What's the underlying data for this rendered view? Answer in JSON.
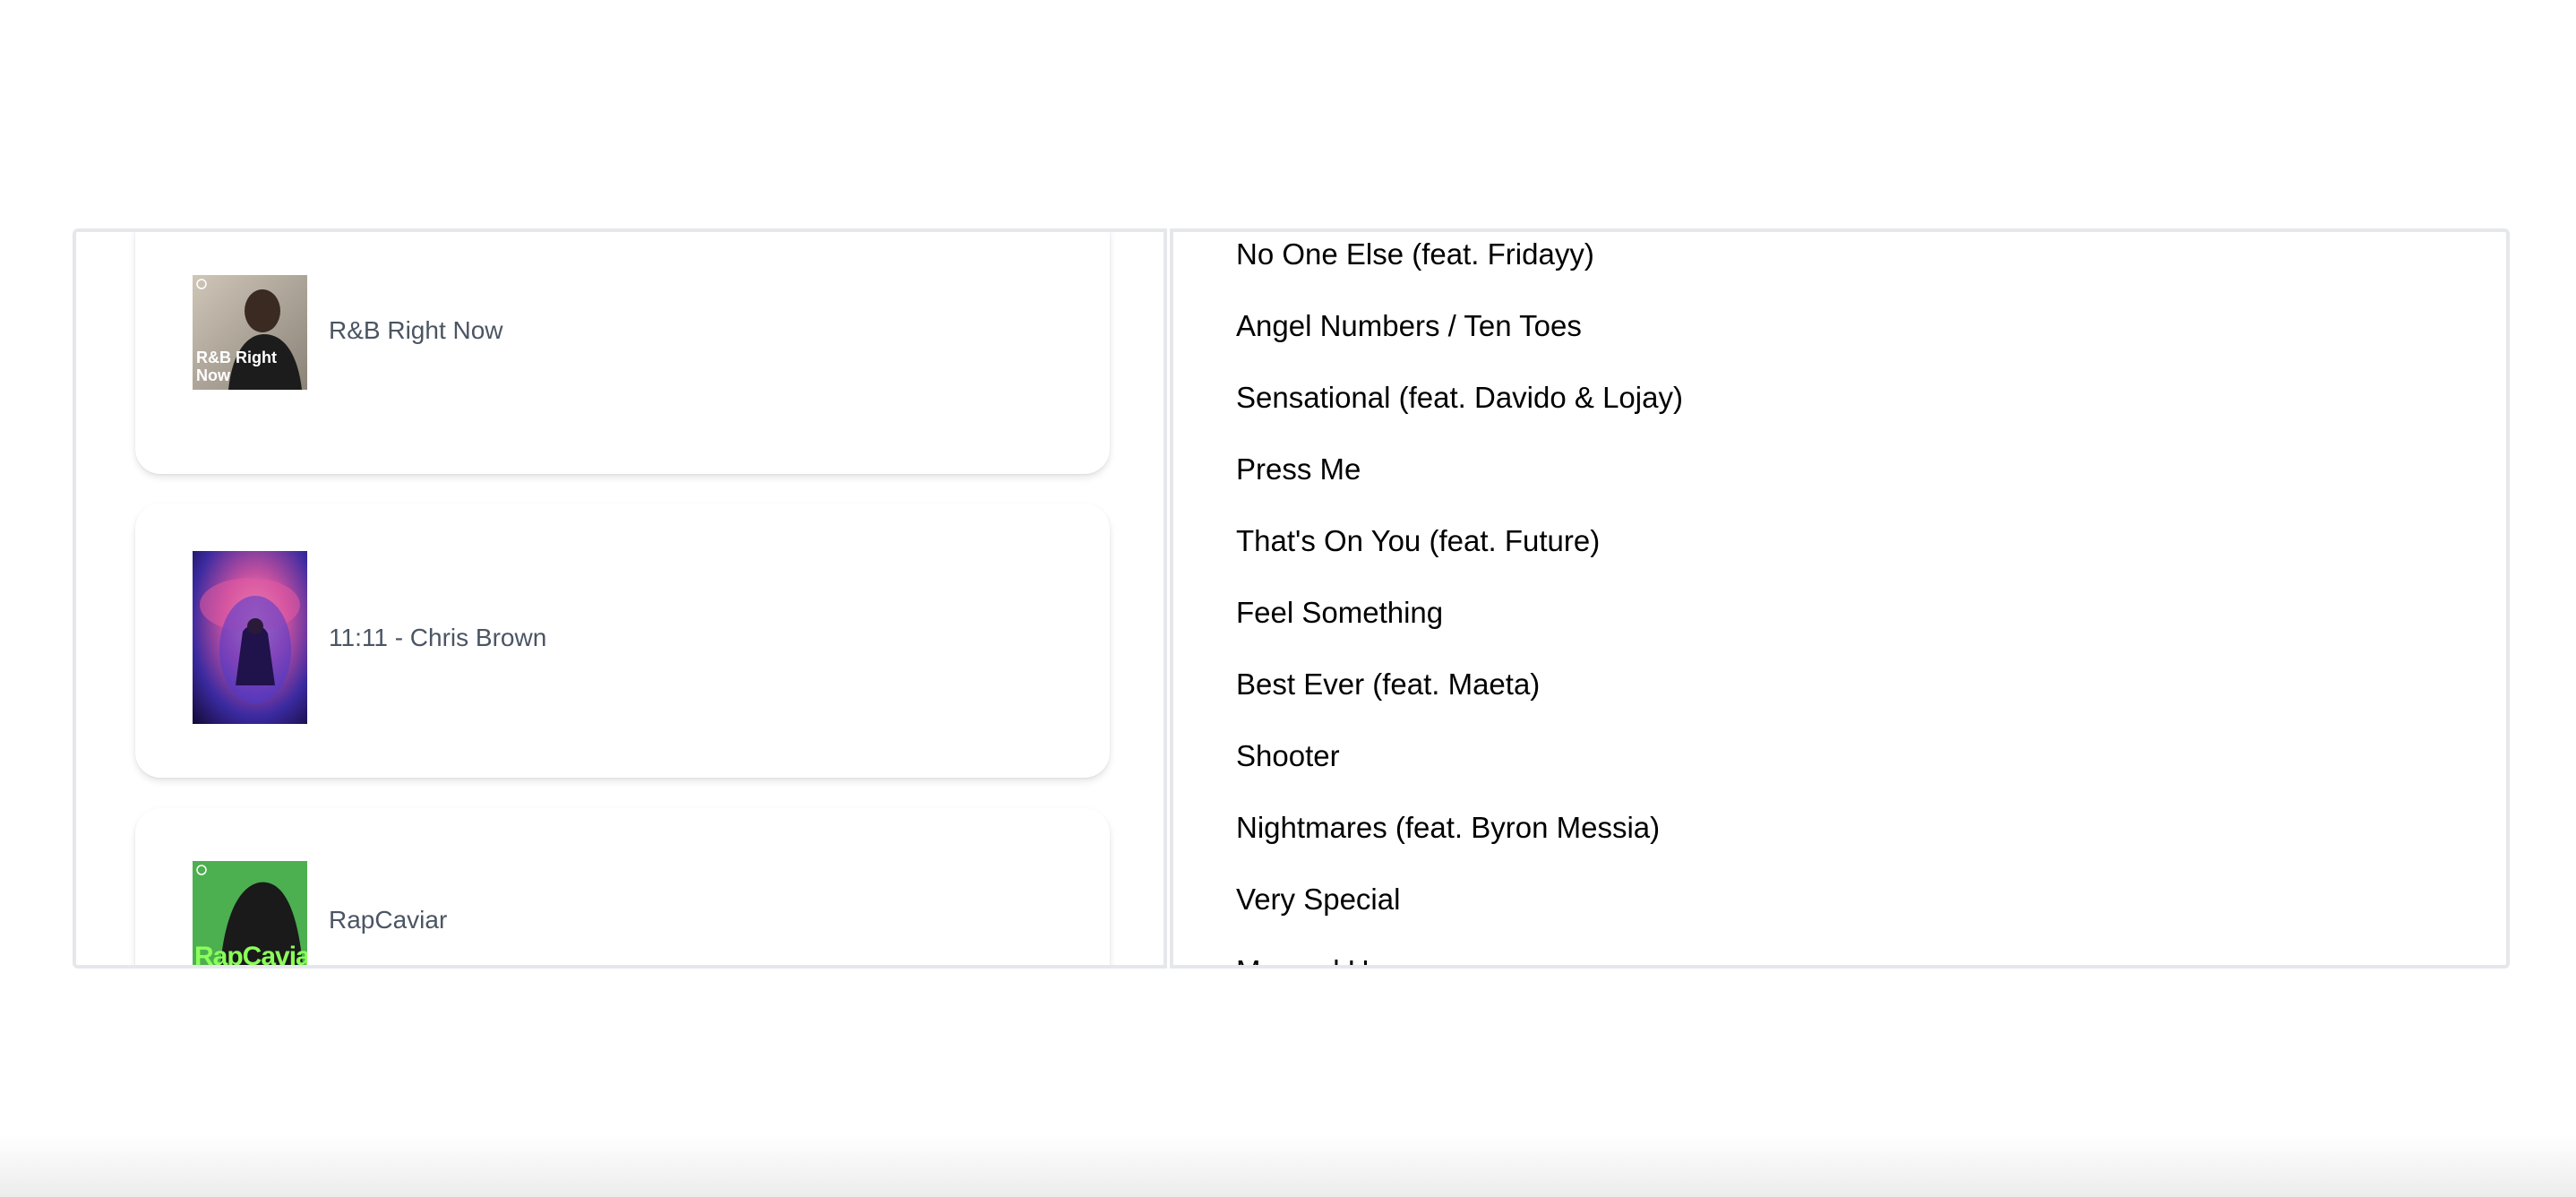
{
  "playlists": [
    {
      "name": "R&B Right Now",
      "cover_text": "R&B Right Now",
      "cover_icon": "spotify-icon"
    },
    {
      "name": "11:11 - Chris Brown",
      "cover_text": "",
      "cover_icon": ""
    },
    {
      "name": "RapCaviar",
      "cover_text": "RapCaviar",
      "cover_icon": "spotify-icon"
    }
  ],
  "tracks": [
    "No One Else (feat. Fridayy)",
    "Angel Numbers / Ten Toes",
    "Sensational (feat. Davido & Lojay)",
    "Press Me",
    "That's On You (feat. Future)",
    "Feel Something",
    "Best Ever (feat. Maeta)",
    "Shooter",
    "Nightmares (feat. Byron Messia)",
    "Very Special",
    "Messed Up"
  ],
  "colors": {
    "panel_border": "#e5e7eb",
    "playlist_text": "#4b5563",
    "track_text": "#000000",
    "rapcaviar_green": "#4caf50"
  }
}
